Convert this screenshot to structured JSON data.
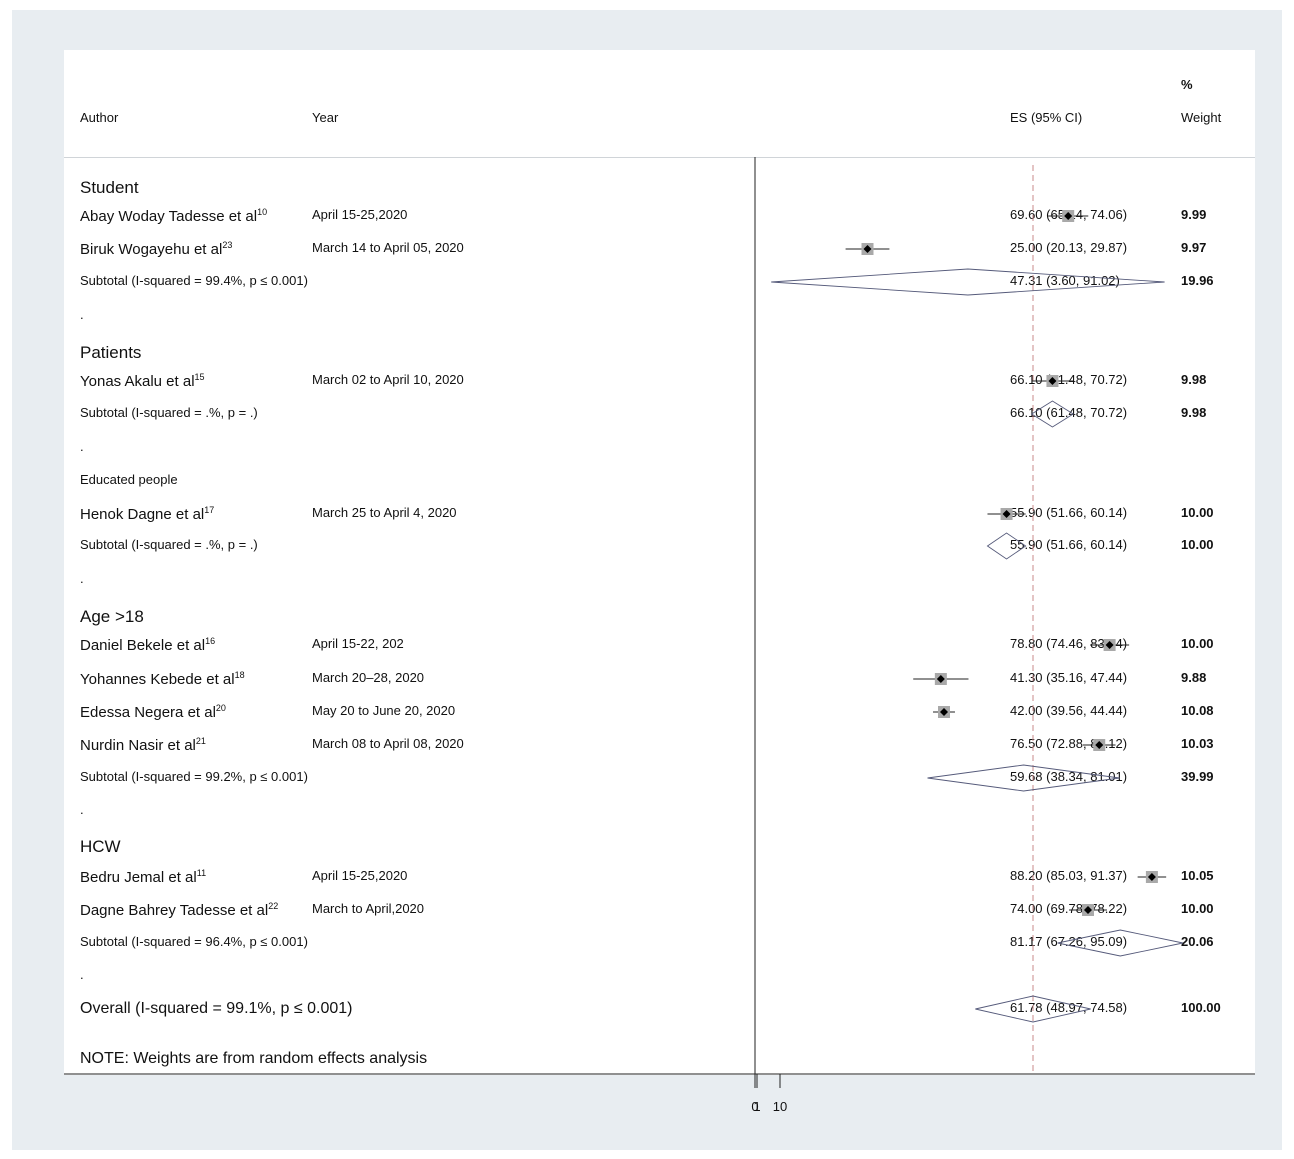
{
  "chart_data": {
    "type": "forest",
    "header": {
      "author": "Author",
      "year": "Year",
      "es": "ES (95% CI)",
      "weight_pct": "%",
      "weight": "Weight"
    },
    "axis": {
      "xlim": [
        0,
        100
      ],
      "ticks": [
        0,
        1,
        10
      ],
      "tick_labels": [
        "0",
        "1",
        "10"
      ],
      "null_line": 0,
      "pooled_line": 61.78
    },
    "rows": [
      {
        "kind": "group",
        "label": "Student",
        "style": "large"
      },
      {
        "kind": "study",
        "author": "Abay Woday Tadesse et al",
        "ref": "10",
        "year": "April 15-25,2020",
        "es": 69.6,
        "lo": 65.14,
        "hi": 74.06,
        "es_text": "69.60 (65.14, 74.06)",
        "weight": "9.99"
      },
      {
        "kind": "study",
        "author": "Biruk Wogayehu et al",
        "ref": "23",
        "year": "March 14 to April 05, 2020",
        "es": 25.0,
        "lo": 20.13,
        "hi": 29.87,
        "es_text": "25.00 (20.13, 29.87)",
        "weight": "9.97"
      },
      {
        "kind": "subtotal",
        "label": "Subtotal  (I-squared = 99.4%, p ≤ 0.001)",
        "es": 47.31,
        "lo": 3.6,
        "hi": 91.02,
        "es_text": "47.31 (3.60, 91.02)",
        "weight": "19.96"
      },
      {
        "kind": "dot",
        "label": "."
      },
      {
        "kind": "group",
        "label": "Patients",
        "style": "large"
      },
      {
        "kind": "study",
        "author": "Yonas Akalu et al",
        "ref": "15",
        "year": "March 02 to April 10, 2020",
        "es": 66.1,
        "lo": 61.48,
        "hi": 70.72,
        "es_text": "66.10 (61.48, 70.72)",
        "weight": "9.98"
      },
      {
        "kind": "subtotal",
        "label": "Subtotal  (I-squared = .%, p = .)",
        "es": 66.1,
        "lo": 61.48,
        "hi": 70.72,
        "es_text": "66.10 (61.48, 70.72)",
        "weight": "9.98"
      },
      {
        "kind": "dot",
        "label": "."
      },
      {
        "kind": "group",
        "label": "Educated people",
        "style": "small"
      },
      {
        "kind": "study",
        "author": "Henok Dagne et al",
        "ref": "17",
        "year": "March 25 to April 4, 2020",
        "es": 55.9,
        "lo": 51.66,
        "hi": 60.14,
        "es_text": "55.90 (51.66, 60.14)",
        "weight": "10.00"
      },
      {
        "kind": "subtotal",
        "label": "Subtotal  (I-squared = .%, p = .)",
        "es": 55.9,
        "lo": 51.66,
        "hi": 60.14,
        "es_text": "55.90 (51.66, 60.14)",
        "weight": "10.00"
      },
      {
        "kind": "dot",
        "label": "."
      },
      {
        "kind": "group",
        "label": "Age >18",
        "style": "large"
      },
      {
        "kind": "study",
        "author": "Daniel Bekele et al",
        "ref": "16",
        "year": "April 15-22, 202",
        "es": 78.8,
        "lo": 74.46,
        "hi": 83.14,
        "es_text": "78.80 (74.46, 83.14)",
        "weight": "10.00"
      },
      {
        "kind": "study",
        "author": "Yohannes Kebede et al",
        "ref": "18",
        "year": "March 20–28,  2020",
        "es": 41.3,
        "lo": 35.16,
        "hi": 47.44,
        "es_text": "41.30 (35.16, 47.44)",
        "weight": "9.88"
      },
      {
        "kind": "study",
        "author": "Edessa Negera et al",
        "ref": "20",
        "year": "May 20 to June 20, 2020",
        "es": 42.0,
        "lo": 39.56,
        "hi": 44.44,
        "es_text": "42.00 (39.56, 44.44)",
        "weight": "10.08"
      },
      {
        "kind": "study",
        "author": "Nurdin Nasir et al",
        "ref": "21",
        "year": "March 08 to April 08, 2020",
        "es": 76.5,
        "lo": 72.88,
        "hi": 80.12,
        "es_text": "76.50 (72.88, 80.12)",
        "weight": "10.03"
      },
      {
        "kind": "subtotal",
        "label": "Subtotal  (I-squared = 99.2%, p ≤ 0.001)",
        "es": 59.68,
        "lo": 38.34,
        "hi": 81.01,
        "es_text": "59.68 (38.34, 81.01)",
        "weight": "39.99"
      },
      {
        "kind": "dot",
        "label": "."
      },
      {
        "kind": "group",
        "label": "HCW",
        "style": "large"
      },
      {
        "kind": "study",
        "author": "Bedru Jemal et al",
        "ref": "11",
        "year": "April 15-25,2020",
        "es": 88.2,
        "lo": 85.03,
        "hi": 91.37,
        "es_text": "88.20 (85.03, 91.37)",
        "weight": "10.05"
      },
      {
        "kind": "study",
        "author": "Dagne Bahrey Tadesse et al",
        "ref": "22",
        "year": "March to April,2020",
        "es": 74.0,
        "lo": 69.78,
        "hi": 78.22,
        "es_text": "74.00 (69.78, 78.22)",
        "weight": "10.00"
      },
      {
        "kind": "subtotal",
        "label": "Subtotal  (I-squared = 96.4%, p ≤ 0.001)",
        "es": 81.17,
        "lo": 67.26,
        "hi": 95.09,
        "es_text": "81.17 (67.26, 95.09)",
        "weight": "20.06"
      },
      {
        "kind": "dot",
        "label": "."
      },
      {
        "kind": "overall",
        "label": "Overall  (I-squared = 99.1%, p ≤ 0.001)",
        "es": 61.78,
        "lo": 48.97,
        "hi": 74.58,
        "es_text": "61.78 (48.97, 74.58)",
        "weight": "100.00"
      }
    ],
    "note": "NOTE: Weights are from random effects analysis"
  }
}
